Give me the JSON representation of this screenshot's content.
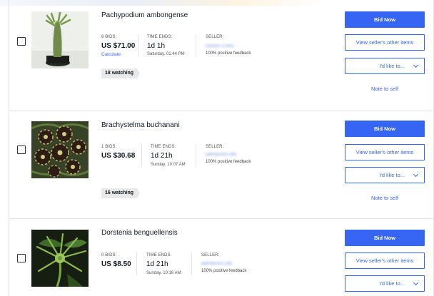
{
  "common": {
    "bid_now": "Bid Now",
    "view_seller": "View seller's other items",
    "id_like": "I'd like to...",
    "note_to_self": "Note to self",
    "time_ends_label": "TIME ENDS:",
    "seller_label": "SELLER:"
  },
  "items": [
    {
      "title": "Pachypodium ambongense",
      "bids": "6 BIDS:",
      "price": "US $71.00",
      "calculate": "Calculate",
      "time_left": "1d 1h",
      "time_end": "Saturday, 01:44 PM",
      "seller": "dominic (1345)",
      "feedback": "100% positive feedback",
      "watching": "18 watching"
    },
    {
      "title": "Brachystelma buchanani",
      "bids": "1 BIDS:",
      "price": "US $30.68",
      "time_left": "1d 21h",
      "time_end": "Sunday, 10:07 AM",
      "seller": "palmai5303 (99)",
      "feedback": "100% positive feedback",
      "watching": "16 watching"
    },
    {
      "title": "Dorstenia benguellensis",
      "bids": "0 BIDS:",
      "price": "US $8.50",
      "time_left": "1d 21h",
      "time_end": "Sunday, 10:16 AM",
      "seller": "palmai5303 (99)",
      "feedback": "100% positive feedback"
    }
  ]
}
